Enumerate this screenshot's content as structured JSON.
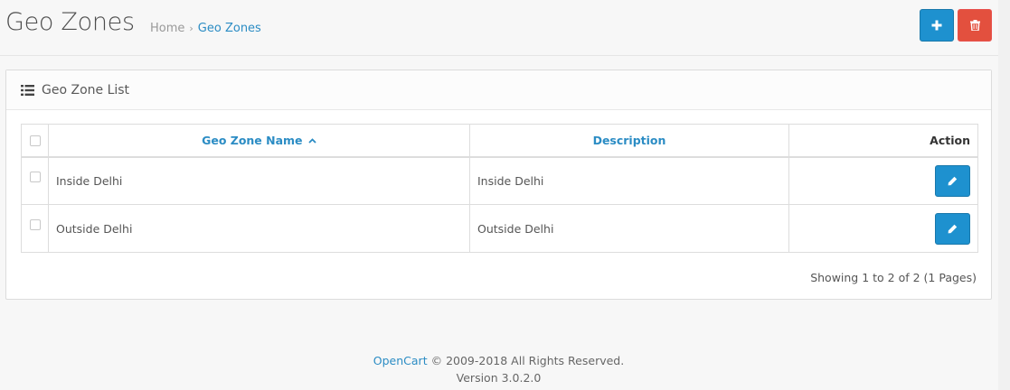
{
  "header": {
    "title": "Geo Zones",
    "breadcrumb": [
      "Home",
      "Geo Zones"
    ],
    "breadcrumb_separator": "›"
  },
  "panel": {
    "title": "Geo Zone List"
  },
  "table": {
    "columns": {
      "name": "Geo Zone Name",
      "description": "Description",
      "action": "Action"
    },
    "sort_indicator": "^",
    "rows": [
      {
        "name": "Inside Delhi",
        "description": "Inside Delhi"
      },
      {
        "name": "Outside Delhi",
        "description": "Outside Delhi"
      }
    ]
  },
  "pagination": {
    "text": "Showing 1 to 2 of 2 (1 Pages)"
  },
  "footer": {
    "brand": "OpenCart",
    "copyright": "© 2009-2018 All Rights Reserved.",
    "version": "Version 3.0.2.0"
  },
  "icons": {
    "add": "plus-icon",
    "delete": "trash-icon",
    "list": "list-icon",
    "edit": "pencil-icon"
  },
  "colors": {
    "primary": "#1e91cf",
    "danger": "#e3503e",
    "link": "#2b8cc4"
  }
}
